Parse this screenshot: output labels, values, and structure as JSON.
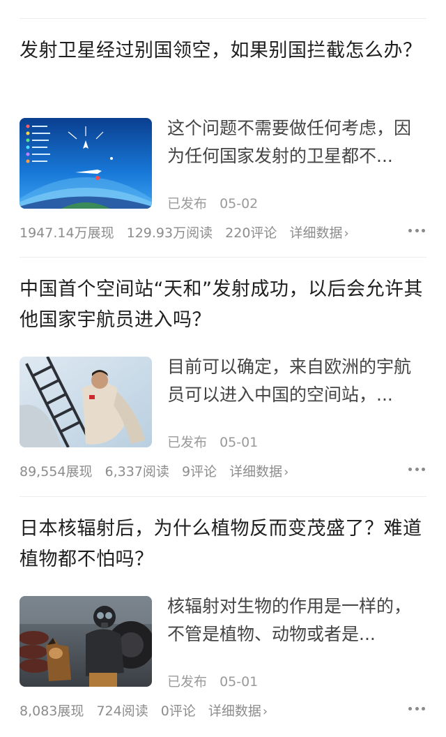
{
  "articles": [
    {
      "title": "发射卫星经过别国领空，如果别国拦截怎么办？",
      "summary": "这个问题不需要做任何考虑，因为任何国家发射的卫星都不...",
      "status": "已发布",
      "date": "05-02",
      "views": "1947.14万展现",
      "reads": "129.93万阅读",
      "comments": "220评论",
      "detail": "详细数据",
      "thumbnail": "atmosphere-layers-infographic"
    },
    {
      "title": "中国首个空间站“天和”发射成功，以后会允许其他国家宇航员进入吗？",
      "summary": "目前可以确定，来自欧洲的宇航员可以进入中国的空间站，...",
      "status": "已发布",
      "date": "05-01",
      "views": "89,554展现",
      "reads": "6,337阅读",
      "comments": "9评论",
      "detail": "详细数据",
      "thumbnail": "astronaut-climbing-ladder-photo"
    },
    {
      "title": "日本核辐射后，为什么植物反而变茂盛了？难道植物都不怕吗？",
      "summary": "核辐射对生物的作用是一样的，不管是植物、动物或者是...",
      "status": "已发布",
      "date": "05-01",
      "views": "8,083展现",
      "reads": "724阅读",
      "comments": "0评论",
      "detail": "详细数据",
      "thumbnail": "gas-mask-person-with-dog-photo"
    }
  ],
  "icons": {
    "chevron": "chevron-right-icon",
    "more": "more-dots-icon"
  },
  "colors": {
    "title": "#1f1f1f",
    "summary": "#444444",
    "meta": "#9a9a9a",
    "divider": "#ececec"
  }
}
